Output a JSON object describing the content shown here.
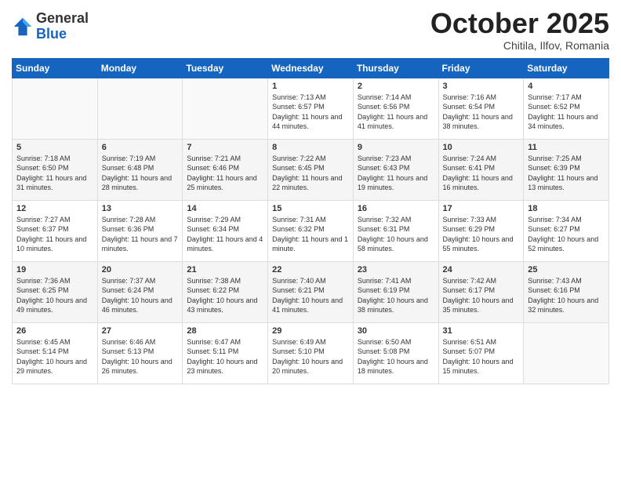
{
  "header": {
    "logo_general": "General",
    "logo_blue": "Blue",
    "month": "October 2025",
    "location": "Chitila, Ilfov, Romania"
  },
  "weekdays": [
    "Sunday",
    "Monday",
    "Tuesday",
    "Wednesday",
    "Thursday",
    "Friday",
    "Saturday"
  ],
  "weeks": [
    [
      {
        "day": "",
        "sunrise": "",
        "sunset": "",
        "daylight": ""
      },
      {
        "day": "",
        "sunrise": "",
        "sunset": "",
        "daylight": ""
      },
      {
        "day": "",
        "sunrise": "",
        "sunset": "",
        "daylight": ""
      },
      {
        "day": "1",
        "sunrise": "Sunrise: 7:13 AM",
        "sunset": "Sunset: 6:57 PM",
        "daylight": "Daylight: 11 hours and 44 minutes."
      },
      {
        "day": "2",
        "sunrise": "Sunrise: 7:14 AM",
        "sunset": "Sunset: 6:56 PM",
        "daylight": "Daylight: 11 hours and 41 minutes."
      },
      {
        "day": "3",
        "sunrise": "Sunrise: 7:16 AM",
        "sunset": "Sunset: 6:54 PM",
        "daylight": "Daylight: 11 hours and 38 minutes."
      },
      {
        "day": "4",
        "sunrise": "Sunrise: 7:17 AM",
        "sunset": "Sunset: 6:52 PM",
        "daylight": "Daylight: 11 hours and 34 minutes."
      }
    ],
    [
      {
        "day": "5",
        "sunrise": "Sunrise: 7:18 AM",
        "sunset": "Sunset: 6:50 PM",
        "daylight": "Daylight: 11 hours and 31 minutes."
      },
      {
        "day": "6",
        "sunrise": "Sunrise: 7:19 AM",
        "sunset": "Sunset: 6:48 PM",
        "daylight": "Daylight: 11 hours and 28 minutes."
      },
      {
        "day": "7",
        "sunrise": "Sunrise: 7:21 AM",
        "sunset": "Sunset: 6:46 PM",
        "daylight": "Daylight: 11 hours and 25 minutes."
      },
      {
        "day": "8",
        "sunrise": "Sunrise: 7:22 AM",
        "sunset": "Sunset: 6:45 PM",
        "daylight": "Daylight: 11 hours and 22 minutes."
      },
      {
        "day": "9",
        "sunrise": "Sunrise: 7:23 AM",
        "sunset": "Sunset: 6:43 PM",
        "daylight": "Daylight: 11 hours and 19 minutes."
      },
      {
        "day": "10",
        "sunrise": "Sunrise: 7:24 AM",
        "sunset": "Sunset: 6:41 PM",
        "daylight": "Daylight: 11 hours and 16 minutes."
      },
      {
        "day": "11",
        "sunrise": "Sunrise: 7:25 AM",
        "sunset": "Sunset: 6:39 PM",
        "daylight": "Daylight: 11 hours and 13 minutes."
      }
    ],
    [
      {
        "day": "12",
        "sunrise": "Sunrise: 7:27 AM",
        "sunset": "Sunset: 6:37 PM",
        "daylight": "Daylight: 11 hours and 10 minutes."
      },
      {
        "day": "13",
        "sunrise": "Sunrise: 7:28 AM",
        "sunset": "Sunset: 6:36 PM",
        "daylight": "Daylight: 11 hours and 7 minutes."
      },
      {
        "day": "14",
        "sunrise": "Sunrise: 7:29 AM",
        "sunset": "Sunset: 6:34 PM",
        "daylight": "Daylight: 11 hours and 4 minutes."
      },
      {
        "day": "15",
        "sunrise": "Sunrise: 7:31 AM",
        "sunset": "Sunset: 6:32 PM",
        "daylight": "Daylight: 11 hours and 1 minute."
      },
      {
        "day": "16",
        "sunrise": "Sunrise: 7:32 AM",
        "sunset": "Sunset: 6:31 PM",
        "daylight": "Daylight: 10 hours and 58 minutes."
      },
      {
        "day": "17",
        "sunrise": "Sunrise: 7:33 AM",
        "sunset": "Sunset: 6:29 PM",
        "daylight": "Daylight: 10 hours and 55 minutes."
      },
      {
        "day": "18",
        "sunrise": "Sunrise: 7:34 AM",
        "sunset": "Sunset: 6:27 PM",
        "daylight": "Daylight: 10 hours and 52 minutes."
      }
    ],
    [
      {
        "day": "19",
        "sunrise": "Sunrise: 7:36 AM",
        "sunset": "Sunset: 6:25 PM",
        "daylight": "Daylight: 10 hours and 49 minutes."
      },
      {
        "day": "20",
        "sunrise": "Sunrise: 7:37 AM",
        "sunset": "Sunset: 6:24 PM",
        "daylight": "Daylight: 10 hours and 46 minutes."
      },
      {
        "day": "21",
        "sunrise": "Sunrise: 7:38 AM",
        "sunset": "Sunset: 6:22 PM",
        "daylight": "Daylight: 10 hours and 43 minutes."
      },
      {
        "day": "22",
        "sunrise": "Sunrise: 7:40 AM",
        "sunset": "Sunset: 6:21 PM",
        "daylight": "Daylight: 10 hours and 41 minutes."
      },
      {
        "day": "23",
        "sunrise": "Sunrise: 7:41 AM",
        "sunset": "Sunset: 6:19 PM",
        "daylight": "Daylight: 10 hours and 38 minutes."
      },
      {
        "day": "24",
        "sunrise": "Sunrise: 7:42 AM",
        "sunset": "Sunset: 6:17 PM",
        "daylight": "Daylight: 10 hours and 35 minutes."
      },
      {
        "day": "25",
        "sunrise": "Sunrise: 7:43 AM",
        "sunset": "Sunset: 6:16 PM",
        "daylight": "Daylight: 10 hours and 32 minutes."
      }
    ],
    [
      {
        "day": "26",
        "sunrise": "Sunrise: 6:45 AM",
        "sunset": "Sunset: 5:14 PM",
        "daylight": "Daylight: 10 hours and 29 minutes."
      },
      {
        "day": "27",
        "sunrise": "Sunrise: 6:46 AM",
        "sunset": "Sunset: 5:13 PM",
        "daylight": "Daylight: 10 hours and 26 minutes."
      },
      {
        "day": "28",
        "sunrise": "Sunrise: 6:47 AM",
        "sunset": "Sunset: 5:11 PM",
        "daylight": "Daylight: 10 hours and 23 minutes."
      },
      {
        "day": "29",
        "sunrise": "Sunrise: 6:49 AM",
        "sunset": "Sunset: 5:10 PM",
        "daylight": "Daylight: 10 hours and 20 minutes."
      },
      {
        "day": "30",
        "sunrise": "Sunrise: 6:50 AM",
        "sunset": "Sunset: 5:08 PM",
        "daylight": "Daylight: 10 hours and 18 minutes."
      },
      {
        "day": "31",
        "sunrise": "Sunrise: 6:51 AM",
        "sunset": "Sunset: 5:07 PM",
        "daylight": "Daylight: 10 hours and 15 minutes."
      },
      {
        "day": "",
        "sunrise": "",
        "sunset": "",
        "daylight": ""
      }
    ]
  ]
}
